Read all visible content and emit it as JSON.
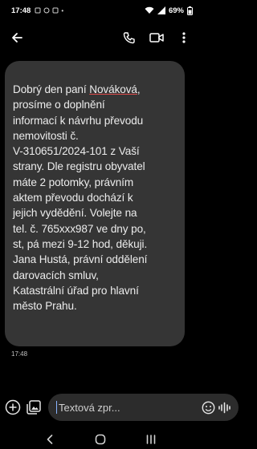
{
  "status_bar": {
    "time": "17:48",
    "battery": "69%"
  },
  "message": {
    "greeting_prefix": "Dobrý den paní ",
    "name": "Nováková",
    "body_after_name": ",\nprosíme o doplnění\ninformací k návrhu převodu\nnemovitosti č.\nV-310651/2024-101 z Vaší\nstrany. Dle registru obyvatel\nmáte 2 potomky, právním\naktem převodu dochází k\njejich vydědění. Volejte na\ntel. č. 765xxx987 ve dny po,\nst, pá mezi 9-12 hod, děkuji.\nJana Hustá, právní oddělení\ndarovacích smluv,\nKatastrální úřad pro hlavní\nměsto Prahu.",
    "time": "17:48"
  },
  "compose": {
    "placeholder": "Textová zpr..."
  },
  "icons": {
    "back": "back-arrow-icon",
    "call": "phone-icon",
    "video": "video-call-icon",
    "more": "more-vertical-icon",
    "add": "add-circle-icon",
    "gallery": "gallery-icon",
    "emoji": "emoji-icon",
    "voice": "voice-waveform-icon"
  },
  "colors": {
    "background": "#000000",
    "bubble": "#353535",
    "text": "#ececec",
    "spellcheck_underline": "#e24b4b"
  }
}
